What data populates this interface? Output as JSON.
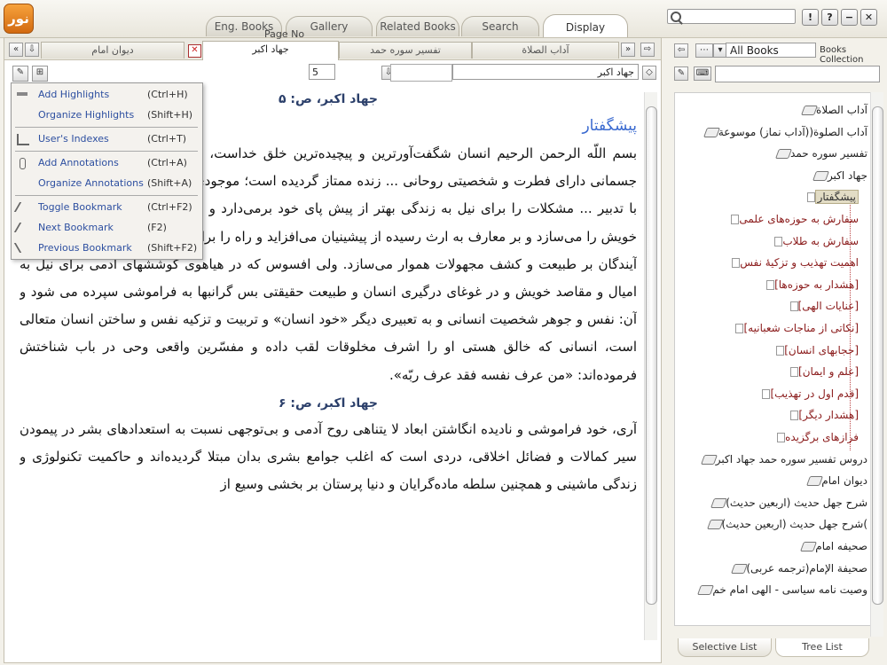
{
  "app": {
    "logo_text": "نور",
    "tabs": [
      {
        "label": "Eng. Books"
      },
      {
        "label": "Gallery"
      },
      {
        "label": "Related Books"
      },
      {
        "label": "Search"
      },
      {
        "label": "Display"
      }
    ],
    "window_buttons": [
      "!",
      "?",
      "−",
      "✕"
    ]
  },
  "doc_tabs": [
    {
      "label": "دیوان امام"
    },
    {
      "label": "جهاد اکبر"
    },
    {
      "label": "تفسیر سوره حمد"
    },
    {
      "label": "آداب الصلاة"
    }
  ],
  "toolbar": {
    "page_label": "Page No",
    "page_value": "5",
    "book_field": "جهاد اکبر"
  },
  "menu": {
    "items": [
      {
        "label": "Add Highlights",
        "shortcut": "(Ctrl+H)"
      },
      {
        "label": "Organize Highlights",
        "shortcut": "(Shift+H)"
      },
      {
        "label": "User's Indexes",
        "shortcut": "(Ctrl+T)"
      },
      {
        "label": "Add Annotations",
        "shortcut": "(Ctrl+A)"
      },
      {
        "label": "Organize Annotations",
        "shortcut": "(Shift+A)"
      },
      {
        "label": "Toggle Bookmark",
        "shortcut": "(Ctrl+F2)"
      },
      {
        "label": "Next Bookmark",
        "shortcut": "(F2)"
      },
      {
        "label": "Previous Bookmark",
        "shortcut": "(Shift+F2)"
      }
    ]
  },
  "content": {
    "page5_head": "جهاد اکبر، ص: ۵",
    "section_head": "پیشگفتار",
    "para1": "بسم اللّه الرحمن الرحیم انسان شگفت‌آورترین و پیچیده‌ترین خلق خداست، ... طبیعی و حیوانی و واکنشهای جسمانی دارای فطرت و شخصیتی روحانی ... زنده ممتاز گردیده است؛ موجودی که می‌اندیشد، انتخاب می‌کند و با تدبیر ... مشکلات را برای نیل به زندگی بهتر از پیش پای خود برمی‌دارد و به موازات این تلاش، تاریخ حیات خویش را می‌سازد و بر معارف به ارث رسیده از پیشینیان می‌افزاید و راه را برای تحولات سریعتر و تسلط بیشتر آیندگان بر طبیعت و کشف مجهولات هموار می‌سازد. ولی افسوس که در هیاهوی کوششهای آدمی برای نیل به امیال و مقاصد خویش و در غوغای درگیری انسان و طبیعت حقیقتی بس گرانبها به فراموشی سپرده می شود و آن: نفس و جوهر شخصیت انسانی و به تعبیری دیگر «خود انسان» و تربیت و تزکیه نفس و ساختن انسان متعالی است، انسانی که خالق هستی او را اشرف مخلوقات لقب داده و مفسّرین واقعی وحی در باب شناختش فرموده‌اند: «من عرف نفسه فقد عرف ربّه».",
    "page6_head": "جهاد اکبر، ص: ۶",
    "para2": "آری، خود فراموشی و نادیده انگاشتن ابعاد لا یتناهی روح آدمی و بی‌توجهی نسبت به استعدادهای بشر در پیمودن سیر کمالات و فضائل اخلاقی، دردی است که اغلب جوامع بشری بدان مبتلا گردیده‌اند و حاکمیت تکنولوژی و زندگی ماشینی و همچنین سلطه ماده‌گرایان و دنیا پرستان بر بخشی وسیع از"
  },
  "side": {
    "collection_select": "All Books",
    "collection_label": "Books Collection",
    "tree": [
      {
        "label": "آداب الصلاة",
        "level": 0
      },
      {
        "label": "آداب الصلوة((آداب نماز) موسوعة",
        "level": 0
      },
      {
        "label": "تفسیر سوره حمد",
        "level": 0
      },
      {
        "label": "جهاد اکبر",
        "level": 0
      },
      {
        "label": "پیشگفتار",
        "level": 1,
        "selected": true
      },
      {
        "label": "سفارش به حوزه‌های علمی",
        "level": 1
      },
      {
        "label": "سفارش به طلاب",
        "level": 1
      },
      {
        "label": "اهمیت تهذیب و تزکیهٔ نفس",
        "level": 1
      },
      {
        "label": "[هشدار به حوزه‌ها]",
        "level": 1
      },
      {
        "label": "[عنایات الهی]",
        "level": 1
      },
      {
        "label": "[نکاتی از مناجات شعبانیه]",
        "level": 1
      },
      {
        "label": "[حجابهای انسان]",
        "level": 1
      },
      {
        "label": "[علم و ایمان]",
        "level": 1
      },
      {
        "label": "[قدم اول در تهذیب]",
        "level": 1
      },
      {
        "label": "[هشدار دیگر]",
        "level": 1
      },
      {
        "label": "فرازهای برگزیده",
        "level": 1
      },
      {
        "label": "دروس تفسیر سوره حمد جهاد اکبر",
        "level": 0
      },
      {
        "label": "دیوان امام",
        "level": 0
      },
      {
        "label": "شرح جهل حدیث (اربعین حدیث)",
        "level": 0
      },
      {
        "label": "شرح جهل حدیث (اربعین حدیث)(",
        "level": 0
      },
      {
        "label": "صحیفه امام",
        "level": 0
      },
      {
        "label": "صحیفة الإمام(ترجمه عربی)",
        "level": 0
      },
      {
        "label": "وصیت نامه سیاسی - الهی امام خم",
        "level": 0
      }
    ],
    "bottom_tabs": [
      {
        "label": "Selective List"
      },
      {
        "label": "Tree List"
      }
    ]
  }
}
